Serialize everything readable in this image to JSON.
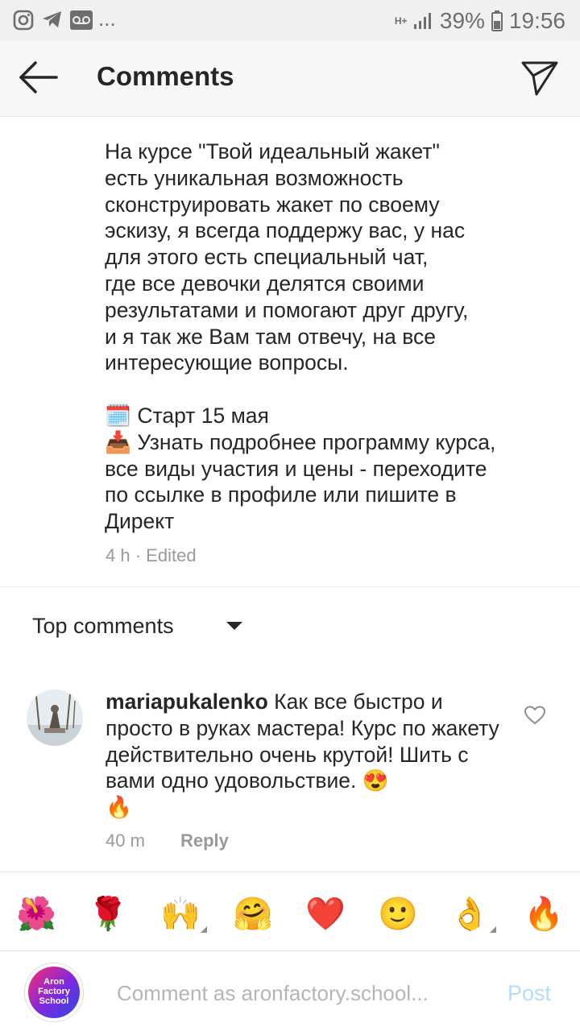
{
  "status_bar": {
    "notification_icons": [
      "instagram-icon",
      "telegram-icon",
      "voicemail-icon"
    ],
    "more_indicator": "...",
    "network": "H+",
    "battery": "39%",
    "time": "19:56"
  },
  "header": {
    "title": "Comments"
  },
  "post": {
    "caption": "На курсе \"Твой идеальный жакет\"\nесть уникальная возможность\nсконструировать жакет по своему\nэскизу, я всегда поддержу вас, у нас\nдля этого есть специальный чат,\nгде все девочки делятся своими\nрезультатами и помогают друг другу,\nи я так же Вам там отвечу, на все\nинтересующие вопросы.",
    "start_line": "Старт 15 мая",
    "details_line": "Узнать подробнее программу курса,\nвсе виды участия и цены - переходите\nпо ссылке в профиле или пишите в\nДирект",
    "time": "4 h",
    "separator": "·",
    "edited": "Edited"
  },
  "sort": {
    "label": "Top comments"
  },
  "comments": [
    {
      "username": "mariapukalenko",
      "text": "Как все быстро и просто в руках мастера! Курс по жакету действительно очень крутой! Шить с вами одно удовольствие.",
      "emojis": [
        "😍",
        "🔥"
      ],
      "time": "40 m",
      "reply_label": "Reply"
    }
  ],
  "quick_emojis": [
    "🌺",
    "🌹",
    "🙌",
    "🤗",
    "❤️",
    "🙂",
    "👌",
    "🔥"
  ],
  "composer": {
    "avatar_text": "Aron\nFactory\nSchool",
    "placeholder": "Comment as aronfactory.school...",
    "post_label": "Post"
  }
}
